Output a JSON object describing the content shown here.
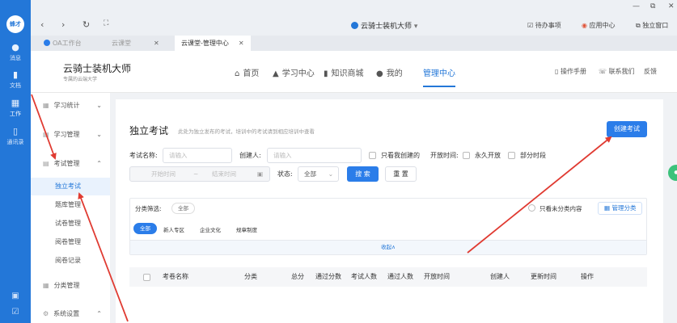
{
  "rail": {
    "avatar": "蜂才",
    "items": [
      {
        "label": "消息",
        "icon": "chat-icon"
      },
      {
        "label": "文档",
        "icon": "document-icon"
      },
      {
        "label": "工作",
        "icon": "grid-icon"
      },
      {
        "label": "通讯录",
        "icon": "contacts-icon"
      }
    ],
    "bottom_icons": [
      "calendar-icon",
      "checkbox-icon"
    ]
  },
  "titlebar": {
    "app_name": "云骑士装机大师",
    "todo": "待办事项",
    "app_center": "应用中心",
    "standalone": "独立窗口"
  },
  "tabs": [
    {
      "label": "OA工作台"
    },
    {
      "label": "云课堂"
    },
    {
      "label": "云课堂-管理中心"
    }
  ],
  "header": {
    "title": "云骑士装机大师",
    "subtitle": "专属的云端大学",
    "nav": [
      "首页",
      "学习中心",
      "知识商城",
      "我的",
      "管理中心"
    ],
    "manual": "操作手册",
    "contact": "联系我们",
    "feedback": "反馈"
  },
  "sidebar": {
    "menus": [
      {
        "label": "学习统计"
      },
      {
        "label": "学习管理"
      },
      {
        "label": "考试管理"
      }
    ],
    "subitems": [
      "独立考试",
      "题库管理",
      "试卷管理",
      "阅卷管理",
      "阅卷记录"
    ],
    "more": [
      {
        "label": "分类管理"
      },
      {
        "label": "系统设置"
      }
    ]
  },
  "main": {
    "title": "独立考试",
    "desc": "此处为独立发布的考试，培训中的考试请到相应培训中查看",
    "create_btn": "创建考试",
    "filters": {
      "name_label": "考试名称:",
      "name_placeholder": "请输入",
      "creator_label": "创建人:",
      "creator_placeholder": "请输入",
      "only_mine": "只看我创建的",
      "open_time_label": "开放时间:",
      "permanent": "永久开放",
      "partial": "部分时段",
      "start_time": "开始时间",
      "tilde": "~",
      "end_time": "结束时间",
      "status_label": "状态:",
      "status_value": "全部",
      "search_btn": "搜 索",
      "reset_btn": "重 置"
    },
    "category": {
      "label": "分类筛选:",
      "current": "全部",
      "only_uncat": "只看未分类内容",
      "manage": "管理分类",
      "tags": [
        "全部",
        "新人专区",
        "企业文化",
        "规章制度"
      ],
      "collapse": "收起∧"
    },
    "table_headers": [
      "考卷名称",
      "分类",
      "总分",
      "通过分数",
      "考试人数",
      "通过人数",
      "开放时间",
      "创建人",
      "更新时间",
      "操作"
    ]
  }
}
